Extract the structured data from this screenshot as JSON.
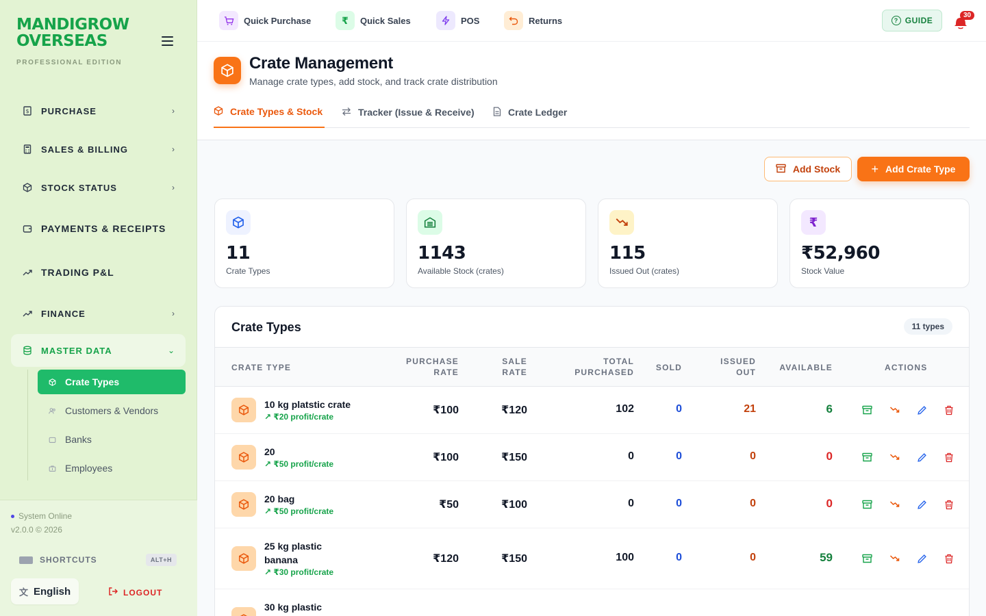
{
  "sidebar": {
    "brand_line1": "MANDIGROW",
    "brand_line2": "OVERSEAS",
    "edition": "PROFESSIONAL EDITION",
    "nav": [
      {
        "label": "PURCHASE",
        "icon": "receipt-icon"
      },
      {
        "label": "SALES & BILLING",
        "icon": "calculator-icon"
      },
      {
        "label": "STOCK STATUS",
        "icon": "box-icon"
      },
      {
        "label": "PAYMENTS & RECEIPTS",
        "icon": "wallet-icon"
      },
      {
        "label": "TRADING P&L",
        "icon": "trend-up-icon"
      },
      {
        "label": "FINANCE",
        "icon": "trend-up-icon"
      },
      {
        "label": "MASTER DATA",
        "icon": "database-icon"
      }
    ],
    "subnav": [
      {
        "label": "Crate Types",
        "icon": "box-icon"
      },
      {
        "label": "Customers & Vendors",
        "icon": "users-icon"
      },
      {
        "label": "Banks",
        "icon": "wallet-icon"
      },
      {
        "label": "Employees",
        "icon": "briefcase-icon"
      }
    ],
    "footer": {
      "status": "System Online",
      "version": "v2.0.0 © 2026",
      "shortcuts": "SHORTCUTS",
      "shortcut_key": "ALT+H",
      "language": "English",
      "logout": "LOGOUT"
    }
  },
  "topbar": {
    "quick": [
      {
        "label": "Quick Purchase",
        "icon": "cart-icon",
        "bg": "#f3e8ff",
        "fg": "#9333ea"
      },
      {
        "label": "Quick Sales",
        "icon": "rupee-icon",
        "bg": "#dcfce7",
        "fg": "#16a34a"
      },
      {
        "label": "POS",
        "icon": "lightning-icon",
        "bg": "#ede9fe",
        "fg": "#7c3aed"
      },
      {
        "label": "Returns",
        "icon": "undo-icon",
        "bg": "#ffedd5",
        "fg": "#ea580c"
      }
    ],
    "guide": "GUIDE",
    "notifications": "30"
  },
  "header": {
    "title": "Crate Management",
    "subtitle": "Manage crate types, add stock, and track crate distribution",
    "tabs": [
      {
        "label": "Crate Types & Stock",
        "icon": "box-icon"
      },
      {
        "label": "Tracker (Issue & Receive)",
        "icon": "swap-icon"
      },
      {
        "label": "Crate Ledger",
        "icon": "document-icon"
      }
    ]
  },
  "actions": {
    "add_stock": "Add Stock",
    "add_crate_type": "Add Crate Type"
  },
  "stats": [
    {
      "value": "11",
      "label": "Crate Types",
      "icon": "box-icon",
      "bg": "#eef2ff",
      "fg": "#2563eb"
    },
    {
      "value": "1143",
      "label": "Available Stock (crates)",
      "icon": "warehouse-icon",
      "bg": "#dcfce7",
      "fg": "#15803d"
    },
    {
      "value": "115",
      "label": "Issued Out (crates)",
      "icon": "trend-down-icon",
      "bg": "#fef3c7",
      "fg": "#c2410c"
    },
    {
      "value": "₹52,960",
      "label": "Stock Value",
      "icon": "rupee-icon",
      "bg": "#f3e8ff",
      "fg": "#7e22ce"
    }
  ],
  "table": {
    "title": "Crate Types",
    "count_badge": "11 types",
    "columns": {
      "crate_type": "CRATE TYPE",
      "purchase_rate_1": "PURCHASE",
      "purchase_rate_2": "RATE",
      "sale_rate_1": "SALE",
      "sale_rate_2": "RATE",
      "total_purchased_1": "TOTAL",
      "total_purchased_2": "PURCHASED",
      "sold": "SOLD",
      "issued_out_1": "ISSUED",
      "issued_out_2": "OUT",
      "available": "AVAILABLE",
      "actions": "ACTIONS"
    },
    "rows": [
      {
        "name": "10 kg platstic crate",
        "profit": "₹20 profit/crate",
        "purchase_rate": "₹100",
        "sale_rate": "₹120",
        "total_purchased": "102",
        "sold": "0",
        "issued_out": "21",
        "available": "6",
        "available_color": "#15803d"
      },
      {
        "name": "20",
        "profit": "₹50 profit/crate",
        "purchase_rate": "₹100",
        "sale_rate": "₹150",
        "total_purchased": "0",
        "sold": "0",
        "issued_out": "0",
        "available": "0",
        "available_color": "#dc2626"
      },
      {
        "name": "20 bag",
        "profit": "₹50 profit/crate",
        "purchase_rate": "₹50",
        "sale_rate": "₹100",
        "total_purchased": "0",
        "sold": "0",
        "issued_out": "0",
        "available": "0",
        "available_color": "#dc2626"
      },
      {
        "name": "25 kg plastic banana",
        "profit": "₹30 profit/crate",
        "purchase_rate": "₹120",
        "sale_rate": "₹150",
        "total_purchased": "100",
        "sold": "0",
        "issued_out": "0",
        "available": "59",
        "available_color": "#15803d"
      },
      {
        "name": "30 kg plastic",
        "profit": "",
        "purchase_rate": "",
        "sale_rate": "",
        "total_purchased": "",
        "sold": "",
        "issued_out": "",
        "available": "",
        "available_color": "#15803d"
      }
    ]
  }
}
